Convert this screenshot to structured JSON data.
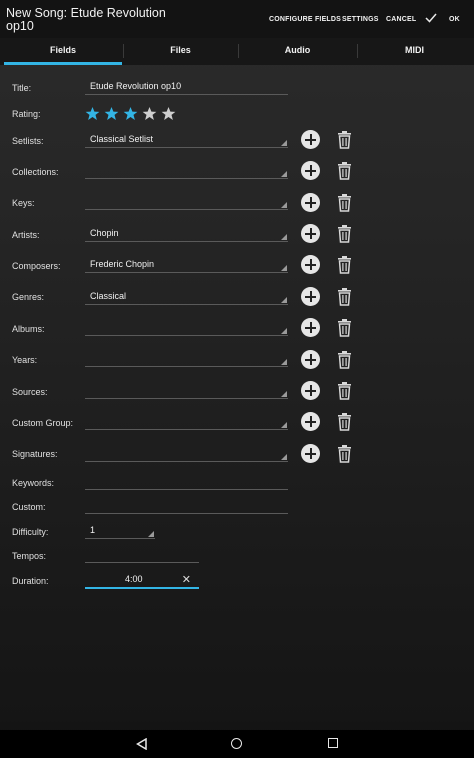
{
  "actionbar": {
    "title": "New Song: Etude Revolution op10",
    "configure_fields": "CONFIGURE FIELDS",
    "settings": "SETTINGS",
    "cancel": "CANCEL",
    "ok": "OK",
    "check_icon": "checkmark-icon"
  },
  "tabs": [
    "Fields",
    "Files",
    "Audio",
    "MIDI"
  ],
  "active_tab": "Fields",
  "accent_color": "#33b5e5",
  "form": {
    "title_label": "Title:",
    "title_value": "Etude Revolution op10",
    "rating_label": "Rating:",
    "rating_value": 3,
    "rating_max": 5,
    "setlists_label": "Setlists:",
    "setlists_value": "Classical Setlist",
    "collections_label": "Collections:",
    "collections_value": "",
    "keys_label": "Keys:",
    "keys_value": "",
    "artists_label": "Artists:",
    "artists_value": "Chopin",
    "composers_label": "Composers:",
    "composers_value": "Frederic Chopin",
    "genres_label": "Genres:",
    "genres_value": "Classical",
    "albums_label": "Albums:",
    "albums_value": "",
    "years_label": "Years:",
    "years_value": "",
    "sources_label": "Sources:",
    "sources_value": "",
    "custom_group_label": "Custom Group:",
    "custom_group_value": "",
    "signatures_label": "Signatures:",
    "signatures_value": "",
    "keywords_label": "Keywords:",
    "keywords_value": "",
    "custom_label": "Custom:",
    "custom_value": "",
    "difficulty_label": "Difficulty:",
    "difficulty_value": "1",
    "tempos_label": "Tempos:",
    "tempos_value": "",
    "duration_label": "Duration:",
    "duration_value": "4:00",
    "clear_glyph": "✕"
  },
  "icons": {
    "add": "add-circle-icon",
    "delete": "trash-icon",
    "star": "star-icon",
    "back": "back-icon",
    "home": "home-icon",
    "recents": "recents-icon"
  }
}
